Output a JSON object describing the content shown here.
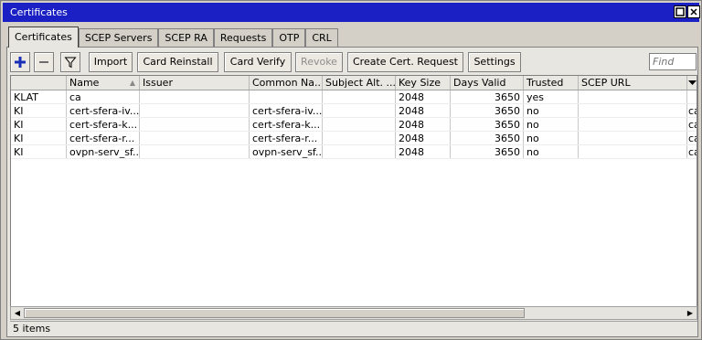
{
  "window": {
    "title": "Certificates"
  },
  "tabs": [
    "Certificates",
    "SCEP Servers",
    "SCEP RA",
    "Requests",
    "OTP",
    "CRL"
  ],
  "toolbar": {
    "add_icon": "plus-icon",
    "remove_icon": "minus-icon",
    "filter_icon": "filter-icon",
    "import": "Import",
    "card_reinstall": "Card Reinstall",
    "card_verify": "Card Verify",
    "revoke": "Revoke",
    "create_request": "Create Cert. Request",
    "settings": "Settings",
    "find_placeholder": "Find"
  },
  "table": {
    "columns": [
      "",
      "Name",
      "Issuer",
      "Common Na...",
      "Subject Alt. ...",
      "Key Size",
      "Days Valid",
      "Trusted",
      "SCEP URL"
    ],
    "rows": [
      {
        "flags": "KLAT",
        "name": "ca",
        "issuer": "",
        "common_name": "",
        "subject_alt": "",
        "key_size": "2048",
        "days_valid": "3650",
        "trusted": "yes",
        "scep_url": "",
        "extra": ""
      },
      {
        "flags": "KI",
        "name": "cert-sfera-iv...",
        "issuer": "",
        "common_name": "cert-sfera-iv...",
        "subject_alt": "",
        "key_size": "2048",
        "days_valid": "3650",
        "trusted": "no",
        "scep_url": "",
        "extra": "ca"
      },
      {
        "flags": "KI",
        "name": "cert-sfera-k...",
        "issuer": "",
        "common_name": "cert-sfera-k...",
        "subject_alt": "",
        "key_size": "2048",
        "days_valid": "3650",
        "trusted": "no",
        "scep_url": "",
        "extra": "ca"
      },
      {
        "flags": "KI",
        "name": "cert-sfera-r...",
        "issuer": "",
        "common_name": "cert-sfera-r...",
        "subject_alt": "",
        "key_size": "2048",
        "days_valid": "3650",
        "trusted": "no",
        "scep_url": "",
        "extra": "ca"
      },
      {
        "flags": "KI",
        "name": "ovpn-serv_sf...",
        "issuer": "",
        "common_name": "ovpn-serv_sf...",
        "subject_alt": "",
        "key_size": "2048",
        "days_valid": "3650",
        "trusted": "no",
        "scep_url": "",
        "extra": "ca"
      }
    ]
  },
  "status": {
    "count": "5 items"
  },
  "colors": {
    "titlebar": "#1b20c4",
    "add_icon": "#1a2fb8",
    "window_bg": "#d4d0c8"
  }
}
